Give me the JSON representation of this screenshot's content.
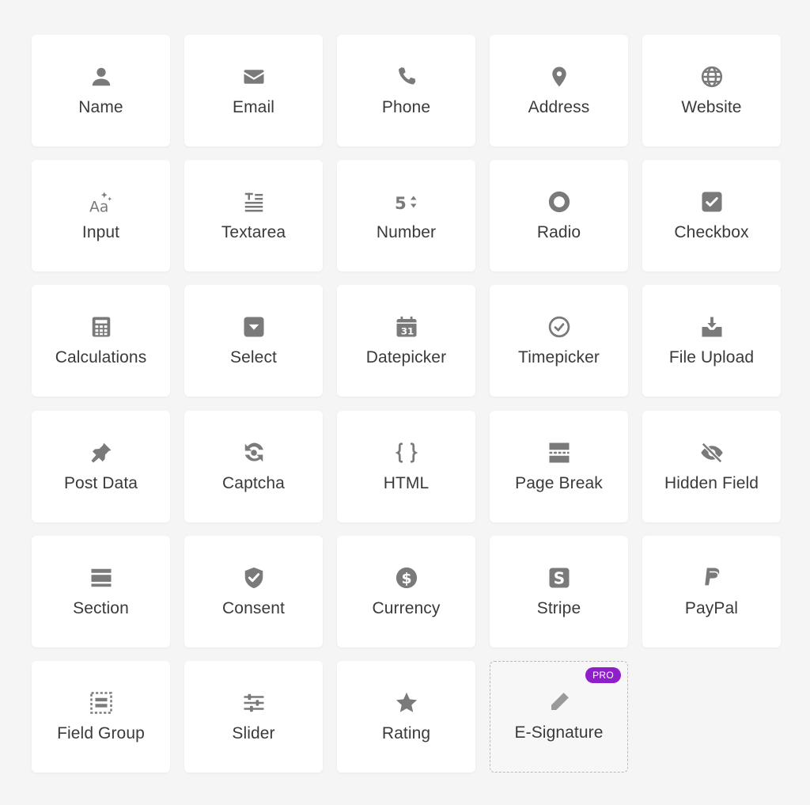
{
  "colors": {
    "icon": "#7a7a7a",
    "label": "#3a3a3a",
    "tile": "#ffffff",
    "background": "#f5f5f5",
    "pro_badge": "#8f1ecb"
  },
  "fields": [
    {
      "id": "name",
      "label": "Name",
      "icon": "user-icon"
    },
    {
      "id": "email",
      "label": "Email",
      "icon": "email-icon"
    },
    {
      "id": "phone",
      "label": "Phone",
      "icon": "phone-icon"
    },
    {
      "id": "address",
      "label": "Address",
      "icon": "map-pin-icon"
    },
    {
      "id": "website",
      "label": "Website",
      "icon": "globe-icon"
    },
    {
      "id": "input",
      "label": "Input",
      "icon": "text-sparkle-icon"
    },
    {
      "id": "textarea",
      "label": "Textarea",
      "icon": "textarea-icon"
    },
    {
      "id": "number",
      "label": "Number",
      "icon": "number-stepper-icon"
    },
    {
      "id": "radio",
      "label": "Radio",
      "icon": "radio-icon"
    },
    {
      "id": "checkbox",
      "label": "Checkbox",
      "icon": "checkbox-icon"
    },
    {
      "id": "calculations",
      "label": "Calculations",
      "icon": "calculator-icon"
    },
    {
      "id": "select",
      "label": "Select",
      "icon": "select-dropdown-icon"
    },
    {
      "id": "datepicker",
      "label": "Datepicker",
      "icon": "calendar-icon"
    },
    {
      "id": "timepicker",
      "label": "Timepicker",
      "icon": "clock-icon"
    },
    {
      "id": "file-upload",
      "label": "File Upload",
      "icon": "upload-tray-icon"
    },
    {
      "id": "post-data",
      "label": "Post Data",
      "icon": "pin-icon"
    },
    {
      "id": "captcha",
      "label": "Captcha",
      "icon": "captcha-icon"
    },
    {
      "id": "html",
      "label": "HTML",
      "icon": "code-braces-icon"
    },
    {
      "id": "page-break",
      "label": "Page Break",
      "icon": "page-break-icon"
    },
    {
      "id": "hidden-field",
      "label": "Hidden Field",
      "icon": "eye-slash-icon"
    },
    {
      "id": "section",
      "label": "Section",
      "icon": "section-icon"
    },
    {
      "id": "consent",
      "label": "Consent",
      "icon": "shield-check-icon"
    },
    {
      "id": "currency",
      "label": "Currency",
      "icon": "dollar-circle-icon"
    },
    {
      "id": "stripe",
      "label": "Stripe",
      "icon": "stripe-icon"
    },
    {
      "id": "paypal",
      "label": "PayPal",
      "icon": "paypal-icon"
    },
    {
      "id": "field-group",
      "label": "Field Group",
      "icon": "field-group-icon"
    },
    {
      "id": "slider",
      "label": "Slider",
      "icon": "sliders-icon"
    },
    {
      "id": "rating",
      "label": "Rating",
      "icon": "star-icon"
    },
    {
      "id": "e-signature",
      "label": "E-Signature",
      "icon": "pencil-icon",
      "badge": "PRO"
    }
  ]
}
